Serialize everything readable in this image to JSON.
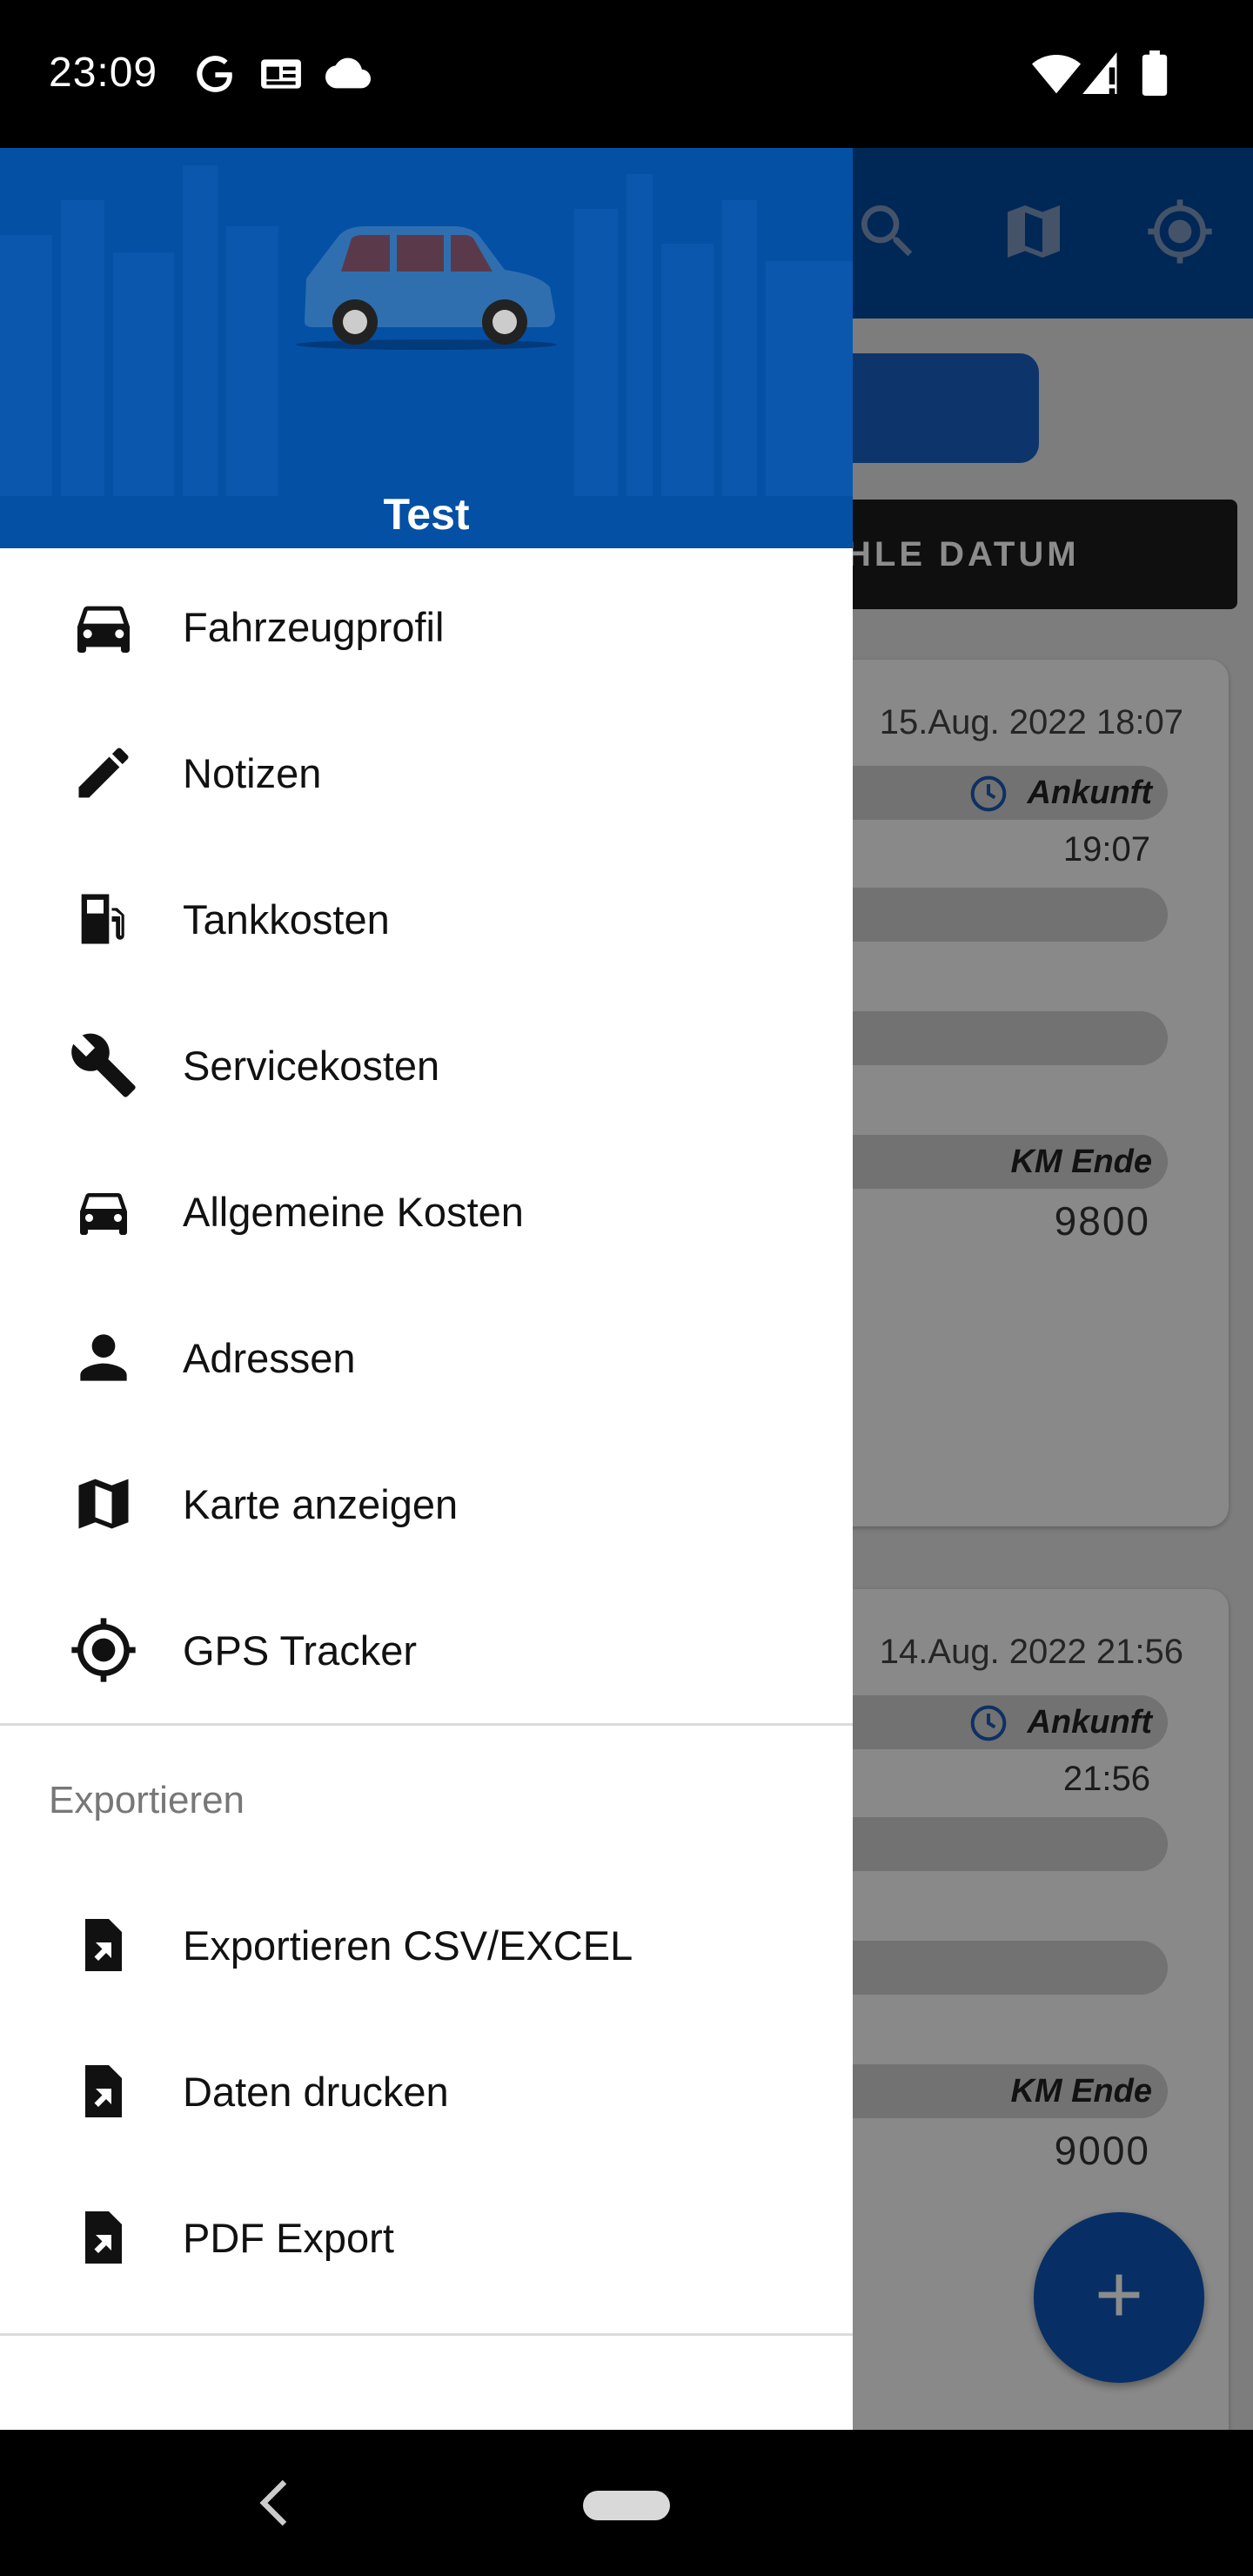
{
  "status_bar": {
    "time": "23:09",
    "left_icons": [
      "google-icon",
      "news-icon",
      "cloud-icon"
    ],
    "right_icons": [
      "wifi-icon",
      "signal-icon",
      "battery-icon"
    ]
  },
  "background_screen": {
    "toolbar_icons": [
      "search-icon",
      "map-icon",
      "gps-icon"
    ],
    "date_button_label": "HLE DATUM",
    "entries": [
      {
        "datetime": "15.Aug. 2022 18:07",
        "arrival_label": "Ankunft",
        "arrival_time": "19:07",
        "km_end_label": "KM Ende",
        "km_end_value": "9800"
      },
      {
        "datetime": "14.Aug. 2022 21:56",
        "arrival_label": "Ankunft",
        "arrival_time": "21:56",
        "km_end_label": "KM Ende",
        "km_end_value": "9000"
      }
    ],
    "fab_label": "+"
  },
  "drawer": {
    "header": {
      "profile_name": "Test",
      "colors": {
        "header_bg": "#0450a4"
      }
    },
    "menu": [
      {
        "label": "Fahrzeugprofil",
        "icon": "car-icon"
      },
      {
        "label": "Notizen",
        "icon": "pencil-icon"
      },
      {
        "label": "Tankkosten",
        "icon": "fuel-icon"
      },
      {
        "label": "Servicekosten",
        "icon": "wrench-icon"
      },
      {
        "label": "Allgemeine Kosten",
        "icon": "car-icon"
      },
      {
        "label": "Adressen",
        "icon": "person-icon"
      },
      {
        "label": "Karte anzeigen",
        "icon": "map-icon"
      },
      {
        "label": "GPS Tracker",
        "icon": "gps-icon"
      }
    ],
    "export_section": {
      "title": "Exportieren",
      "items": [
        {
          "label": "Exportieren CSV/EXCEL",
          "icon": "file-export-icon"
        },
        {
          "label": "Daten drucken",
          "icon": "file-export-icon"
        },
        {
          "label": "PDF Export",
          "icon": "file-export-icon"
        }
      ]
    }
  },
  "colors": {
    "toolbar": "#004a9f",
    "accent": "#0d56b8",
    "scrim": "rgba(0,0,0,0.45)"
  }
}
